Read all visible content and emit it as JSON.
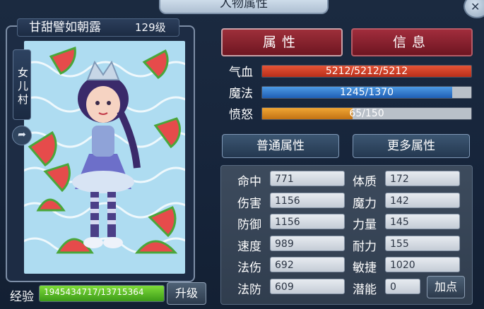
{
  "window": {
    "title": "人物属性"
  },
  "character": {
    "name": "甘甜譬如朝露",
    "level": "129级",
    "village": "女儿村"
  },
  "tabs": {
    "attributes": "属性",
    "info": "信息"
  },
  "vitals": {
    "hp_label": "气血",
    "hp_text": "5212/5212/5212",
    "hp_fill": 1.0,
    "mp_label": "魔法",
    "mp_text": "1245/1370",
    "mp_fill": 0.909,
    "rage_label": "愤怒",
    "rage_text": "65/150",
    "rage_fill": 0.433
  },
  "subtabs": {
    "basic": "普通属性",
    "more": "更多属性"
  },
  "attributes": [
    {
      "k": "命中",
      "v": "771"
    },
    {
      "k": "体质",
      "v": "172"
    },
    {
      "k": "伤害",
      "v": "1156"
    },
    {
      "k": "魔力",
      "v": "142"
    },
    {
      "k": "防御",
      "v": "1156"
    },
    {
      "k": "力量",
      "v": "145"
    },
    {
      "k": "速度",
      "v": "989"
    },
    {
      "k": "耐力",
      "v": "155"
    },
    {
      "k": "法伤",
      "v": "692"
    },
    {
      "k": "敏捷",
      "v": "1020"
    },
    {
      "k": "法防",
      "v": "609"
    },
    {
      "k": "潜能",
      "v": "0"
    }
  ],
  "buttons": {
    "add_point": "加点",
    "upgrade": "升级"
  },
  "exp": {
    "label": "经验",
    "text": "1945434717/13715364",
    "fill": 1.0
  },
  "colors": {
    "accent_red": "#9e2f3a",
    "hp": "#d1432a",
    "mp": "#2f74c9",
    "rage": "#de8b22",
    "exp": "#5cc328"
  },
  "icons": {
    "close": "close-icon",
    "share": "share-icon"
  }
}
